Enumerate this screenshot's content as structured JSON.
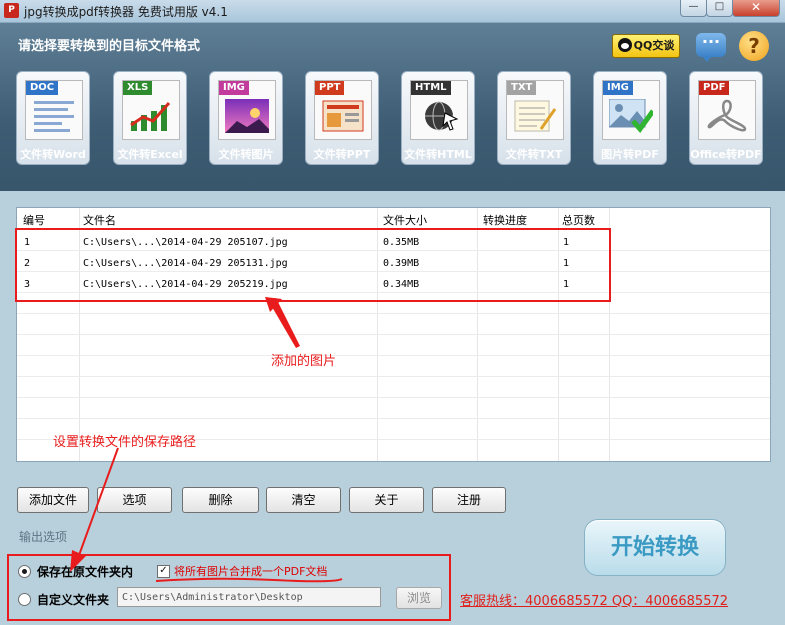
{
  "window": {
    "title": "jpg转换成pdf转换器 免费试用版 v4.1"
  },
  "header": {
    "title": "请选择要转换到的目标文件格式",
    "qq_label": "QQ交谈",
    "tiles": [
      {
        "tag": "DOC",
        "label": "文件转Word",
        "tag_color": "#2f74c6"
      },
      {
        "tag": "XLS",
        "label": "文件转Excel",
        "tag_color": "#2e8b2e"
      },
      {
        "tag": "IMG",
        "label": "文件转图片",
        "tag_color": "#c23a9b"
      },
      {
        "tag": "PPT",
        "label": "文件转PPT",
        "tag_color": "#d03b1e"
      },
      {
        "tag": "HTML",
        "label": "文件转HTML",
        "tag_color": "#333333"
      },
      {
        "tag": "TXT",
        "label": "文件转TXT",
        "tag_color": "#a3a3a3"
      },
      {
        "tag": "IMG",
        "label": "图片转PDF",
        "tag_color": "#2f74c6"
      },
      {
        "tag": "PDF",
        "label": "Office转PDF",
        "tag_color": "#c8271b"
      }
    ]
  },
  "table": {
    "columns": [
      "编号",
      "文件名",
      "文件大小",
      "转换进度",
      "总页数"
    ],
    "rows": [
      {
        "id": "1",
        "name": "C:\\Users\\...\\2014-04-29 205107.jpg",
        "size": "0.35MB",
        "progress": "",
        "pages": "1"
      },
      {
        "id": "2",
        "name": "C:\\Users\\...\\2014-04-29 205131.jpg",
        "size": "0.39MB",
        "progress": "",
        "pages": "1"
      },
      {
        "id": "3",
        "name": "C:\\Users\\...\\2014-04-29 205219.jpg",
        "size": "0.34MB",
        "progress": "",
        "pages": "1"
      }
    ]
  },
  "toolbar": {
    "add": "添加文件",
    "options": "选项",
    "delete": "删除",
    "clear": "清空",
    "about": "关于",
    "register": "注册"
  },
  "output": {
    "section": "输出选项",
    "save_original": "保存在原文件夹内",
    "merge": "将所有图片合并成一个PDF文档",
    "custom": "自定义文件夹",
    "path": "C:\\Users\\Administrator\\Desktop",
    "browse": "浏览"
  },
  "start": "开始转换",
  "hotline": "客服热线：4006685572 QQ：4006685572",
  "annotations": {
    "added_images": "添加的图片",
    "set_path": "设置转换文件的保存路径"
  },
  "colors": {
    "accent_red": "#e81c1c",
    "header_blue": "#3e5d74"
  }
}
